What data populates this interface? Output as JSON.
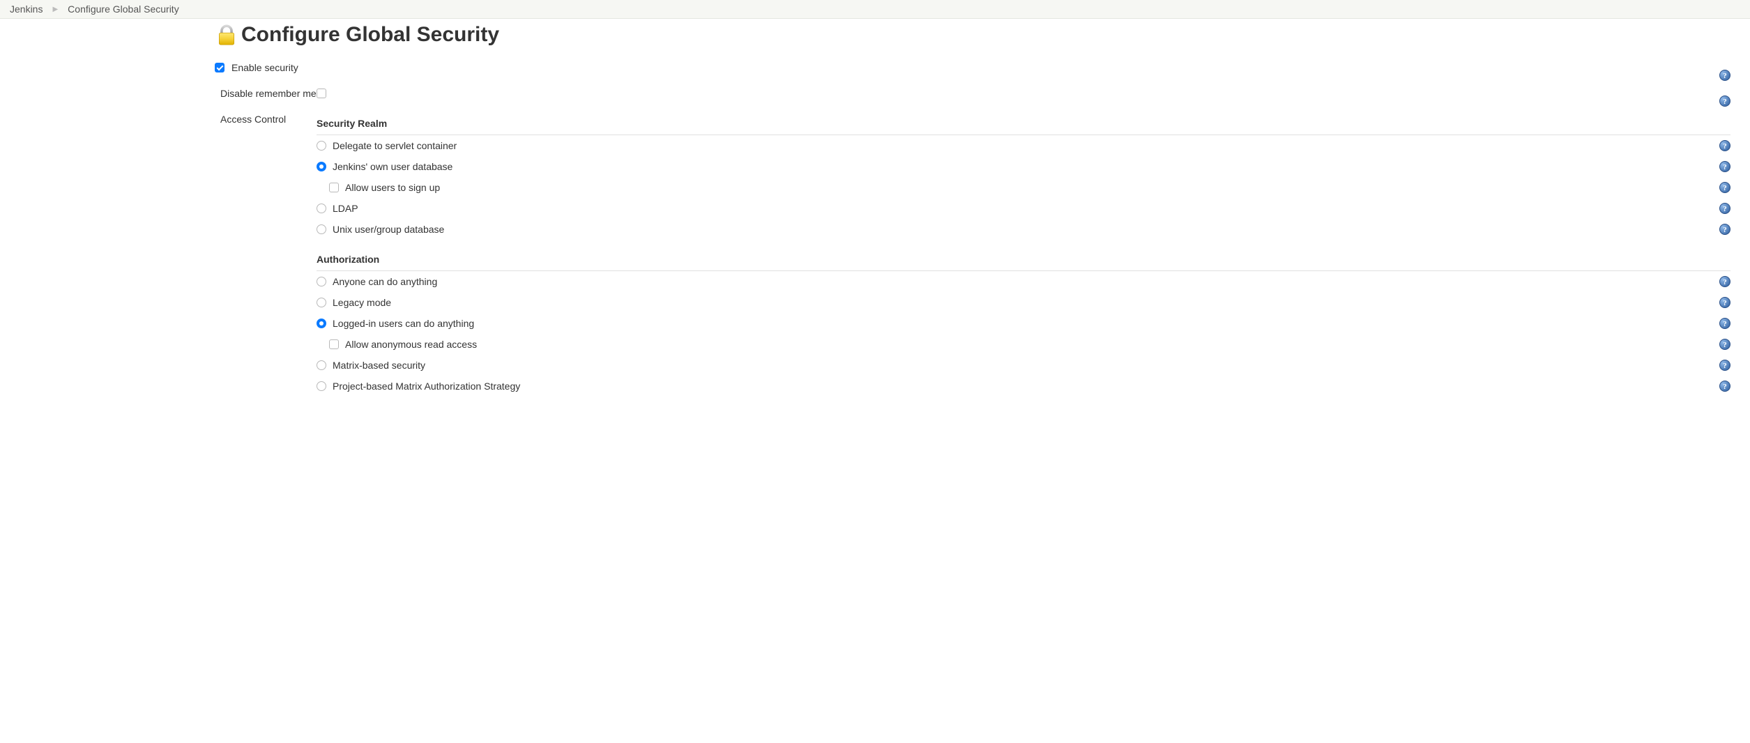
{
  "breadcrumbs": {
    "root": "Jenkins",
    "current": "Configure Global Security"
  },
  "title": "Configure Global Security",
  "enable_security": {
    "label": "Enable security",
    "checked": true
  },
  "disable_remember": {
    "label": "Disable remember me",
    "checked": false
  },
  "access_control": {
    "label": "Access Control",
    "security_realm": {
      "heading": "Security Realm",
      "options": {
        "servlet": {
          "label": "Delegate to servlet container",
          "selected": false
        },
        "own_db": {
          "label": "Jenkins' own user database",
          "selected": true,
          "allow_signup": {
            "label": "Allow users to sign up",
            "checked": false
          }
        },
        "ldap": {
          "label": "LDAP",
          "selected": false
        },
        "unix": {
          "label": "Unix user/group database",
          "selected": false
        }
      }
    },
    "authorization": {
      "heading": "Authorization",
      "options": {
        "anyone": {
          "label": "Anyone can do anything",
          "selected": false
        },
        "legacy": {
          "label": "Legacy mode",
          "selected": false
        },
        "loggedin": {
          "label": "Logged-in users can do anything",
          "selected": true,
          "anon_read": {
            "label": "Allow anonymous read access",
            "checked": false
          }
        },
        "matrix": {
          "label": "Matrix-based security",
          "selected": false
        },
        "project": {
          "label": "Project-based Matrix Authorization Strategy",
          "selected": false
        }
      }
    }
  }
}
